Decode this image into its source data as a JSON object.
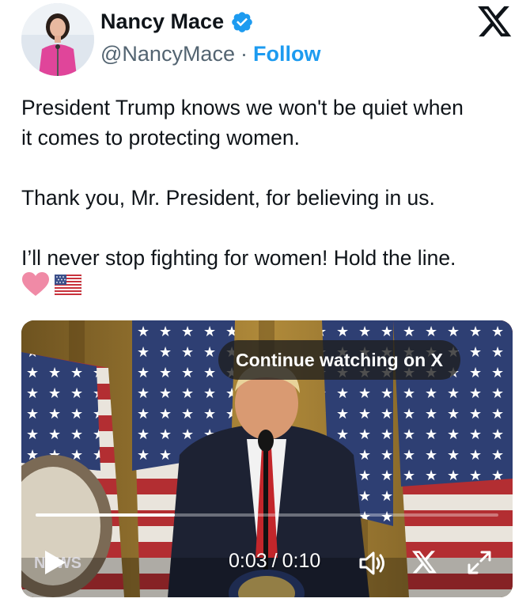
{
  "author": {
    "display_name": "Nancy Mace",
    "handle": "@NancyMace",
    "separator": "·",
    "follow_label": "Follow",
    "verified_icon": "verified-badge-icon",
    "verified_color": "#1d9bf0"
  },
  "brand": {
    "icon": "x-logo-icon"
  },
  "tweet": {
    "line1": "President Trump knows we won't be quiet when",
    "line2": "it comes to protecting women.",
    "line3": "Thank you, Mr. President, for believing in us.",
    "line4": "I’ll never stop fighting for women! Hold the line.",
    "emojis": [
      "pink-heart-icon",
      "us-flag-icon"
    ]
  },
  "video": {
    "continue_label": "Continue watching on X",
    "current_time": "0:03",
    "time_separator": "/",
    "duration": "0:10",
    "progress_fraction": 0.3,
    "watermark_text": "NEWS",
    "controls": [
      "play-icon",
      "volume-icon",
      "x-logo-icon",
      "fullscreen-icon"
    ]
  },
  "colors": {
    "text": "#0f1419",
    "muted": "#536471",
    "accent": "#1d9bf0"
  }
}
